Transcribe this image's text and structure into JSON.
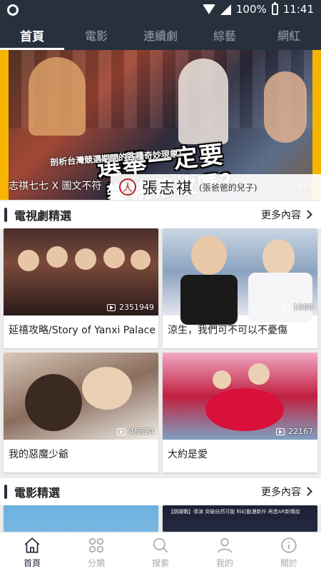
{
  "status_bar": {
    "battery": "100%",
    "time": "11:41"
  },
  "tabs": [
    {
      "label": "首頁",
      "active": true
    },
    {
      "label": "電影",
      "active": false
    },
    {
      "label": "連續劇",
      "active": false
    },
    {
      "label": "綜藝",
      "active": false
    },
    {
      "label": "網紅",
      "active": false
    }
  ],
  "banner": {
    "headline_1": "選舉一定要",
    "headline_2": "攀親帶故嗎？",
    "subline": "剖析台灣競選期間的各種奇妙現象！",
    "caption": "志祺七七 X 圖文不符",
    "name": "張志祺",
    "name_note": "(張爸爸的兒子)"
  },
  "sections": {
    "drama": {
      "title": "電視劇精選",
      "more": "更多內容",
      "items": [
        {
          "title": "延禧攻略/Story of Yanxi Palace",
          "views": "2351949"
        },
        {
          "title": "涼生，我們可不可以不憂傷",
          "views": "1000"
        },
        {
          "title": "我的惡魔少爺",
          "views": "45824"
        },
        {
          "title": "大約是愛",
          "views": "22167"
        }
      ]
    },
    "movie": {
      "title": "電影精選",
      "more": "更多內容",
      "poster_text": "【跳躍戰】導演  突破自然可能  科幻動漫新作  再造AR新傳說"
    }
  },
  "bottom_nav": [
    {
      "label": "首頁",
      "icon": "home-icon",
      "active": true
    },
    {
      "label": "分類",
      "icon": "category-icon",
      "active": false
    },
    {
      "label": "搜索",
      "icon": "search-icon",
      "active": false
    },
    {
      "label": "我的",
      "icon": "profile-icon",
      "active": false
    },
    {
      "label": "關於",
      "icon": "info-icon",
      "active": false
    }
  ],
  "colors": {
    "header_bg": "#27303d",
    "active_tab": "#ffffff",
    "inactive_tab": "#9aa3b0"
  }
}
